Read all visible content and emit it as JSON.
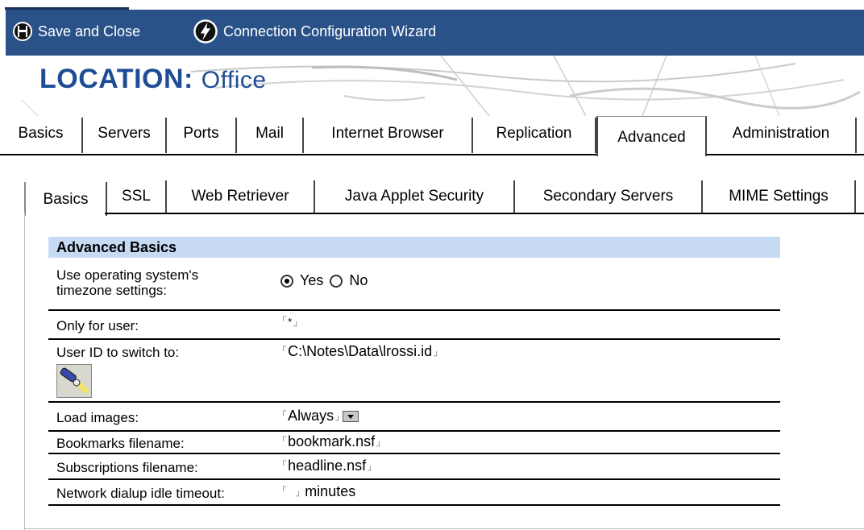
{
  "toolbar": {
    "save_close_label": "Save and Close",
    "save_close_icon": "floppy-disk-icon",
    "wizard_label": "Connection Configuration Wizard",
    "wizard_icon": "lightning-bolt-icon"
  },
  "banner": {
    "title_prefix": "LOCATION",
    "title_sep": ":",
    "title_value": "Office"
  },
  "tabs": [
    {
      "label": "Basics"
    },
    {
      "label": "Servers"
    },
    {
      "label": "Ports"
    },
    {
      "label": "Mail"
    },
    {
      "label": "Internet Browser"
    },
    {
      "label": "Replication"
    },
    {
      "label": "Advanced"
    },
    {
      "label": "Administration"
    }
  ],
  "active_tab": "Advanced",
  "subtabs": [
    {
      "label": "Basics"
    },
    {
      "label": "SSL"
    },
    {
      "label": "Web Retriever"
    },
    {
      "label": "Java Applet Security"
    },
    {
      "label": "Secondary Servers"
    },
    {
      "label": "MIME Settings"
    }
  ],
  "active_subtab": "Basics",
  "form": {
    "section_title": "Advanced Basics",
    "timezone": {
      "label_line1": "Use operating system's",
      "label_line2": "timezone settings:",
      "yes_label": "Yes",
      "no_label": "No",
      "selected": "Yes"
    },
    "only_for_user": {
      "label": "Only for user:",
      "value": "*"
    },
    "user_id": {
      "label": "User ID to switch to:",
      "value": "C:\\Notes\\Data\\lrossi.id",
      "button_icon": "flashlight-icon"
    },
    "load_images": {
      "label": "Load images:",
      "value": "Always"
    },
    "bookmarks": {
      "label": "Bookmarks filename:",
      "value": "bookmark.nsf"
    },
    "subscriptions": {
      "label": "Subscriptions filename:",
      "value": "headline.nsf"
    },
    "dialup_timeout": {
      "label": "Network dialup idle timeout:",
      "value": "",
      "unit": "minutes"
    }
  },
  "colors": {
    "toolbar_bg": "#2a5289",
    "title_blue": "#1e4d93",
    "section_header_bg": "#c6daf4"
  }
}
